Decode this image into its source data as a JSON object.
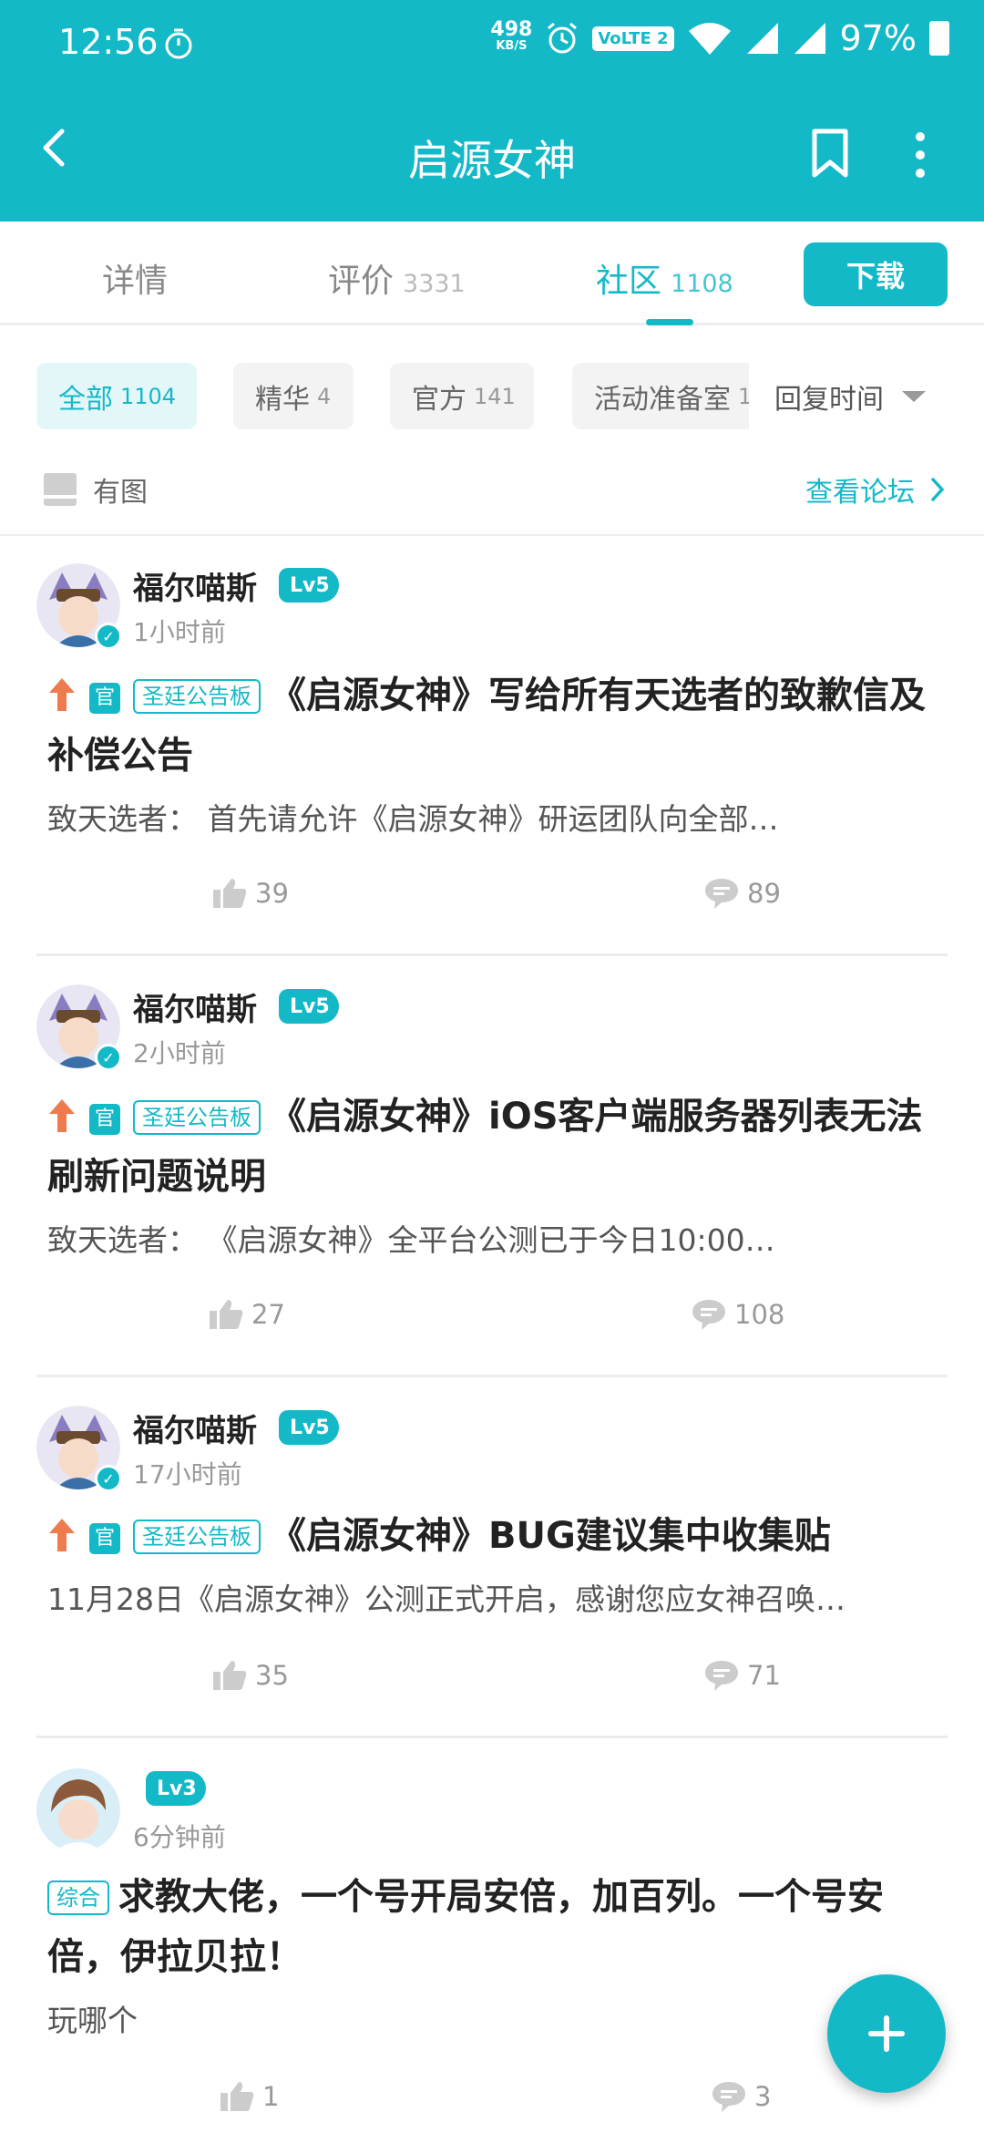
{
  "status_bar": {
    "time": "12:56",
    "speed_value": "498",
    "speed_unit": "KB/S",
    "volte": "VoLTE 2",
    "battery": "97%"
  },
  "nav": {
    "title": "启源女神"
  },
  "tabs": [
    {
      "label": "详情",
      "count": ""
    },
    {
      "label": "评价",
      "count": "3331"
    },
    {
      "label": "社区",
      "count": "1108"
    }
  ],
  "download_label": "下载",
  "filters": [
    {
      "label": "全部",
      "count": "1104"
    },
    {
      "label": "精华",
      "count": "4"
    },
    {
      "label": "官方",
      "count": "141"
    },
    {
      "label": "活动准备室",
      "count": "1"
    }
  ],
  "sort_label": "回复时间",
  "image_filter_label": "有图",
  "forum_link_label": "查看论坛",
  "posts": [
    {
      "user": "福尔喵斯",
      "level": "Lv5",
      "time": "1小时前",
      "official_tag": "官",
      "board": "圣廷公告板",
      "title": "《启源女神》写给所有天选者的致歉信及补偿公告",
      "summary": "致天选者：          首先请允许《启源女神》研运团队向全部…",
      "likes": "39",
      "comments": "89"
    },
    {
      "user": "福尔喵斯",
      "level": "Lv5",
      "time": "2小时前",
      "official_tag": "官",
      "board": "圣廷公告板",
      "title": "《启源女神》iOS客户端服务器列表无法刷新问题说明",
      "summary": "致天选者：            《启源女神》全平台公测已于今日10:00…",
      "likes": "27",
      "comments": "108"
    },
    {
      "user": "福尔喵斯",
      "level": "Lv5",
      "time": "17小时前",
      "official_tag": "官",
      "board": "圣廷公告板",
      "title": "《启源女神》BUG建议集中收集贴",
      "summary": "11月28日《启源女神》公测正式开启，感谢您应女神召唤…",
      "likes": "35",
      "comments": "71"
    },
    {
      "user": "",
      "level": "Lv3",
      "time": "6分钟前",
      "board": "综合",
      "title": "求教大佬，一个号开局安倍，加百列。一个号安倍，伊拉贝拉！",
      "summary": "玩哪个",
      "likes": "1",
      "comments": "3"
    }
  ],
  "colors": {
    "accent": "#14b9c8",
    "arrow": "#ee7b4e"
  }
}
